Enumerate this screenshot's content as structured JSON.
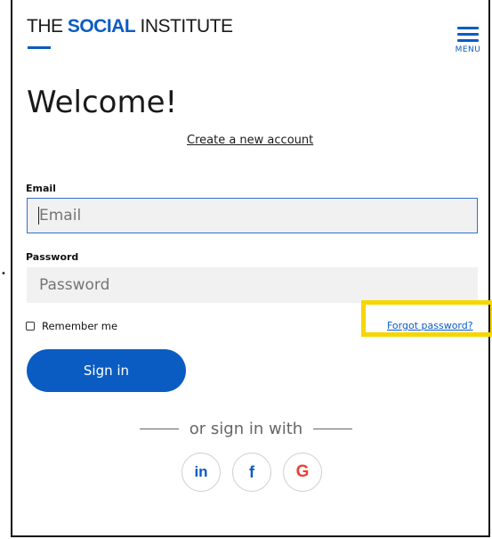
{
  "header": {
    "logo_prefix": "THE ",
    "logo_strong": "SOCIAL",
    "logo_suffix": " INSTITUTE",
    "menu_label": "MENU"
  },
  "main": {
    "title": "Welcome!",
    "create_account": "Create a new account",
    "email_label": "Email",
    "email_placeholder": "Email",
    "password_label": "Password",
    "password_placeholder": "Password",
    "remember_label": "Remember me",
    "forgot_password": "Forgot password?",
    "sign_in": "Sign in",
    "or_sign_in_with": "or sign in with"
  },
  "social": {
    "linkedin": "in",
    "facebook": "f",
    "google": "G"
  },
  "colors": {
    "brand_blue": "#0a5cc2",
    "highlight_yellow": "#f6d600"
  }
}
